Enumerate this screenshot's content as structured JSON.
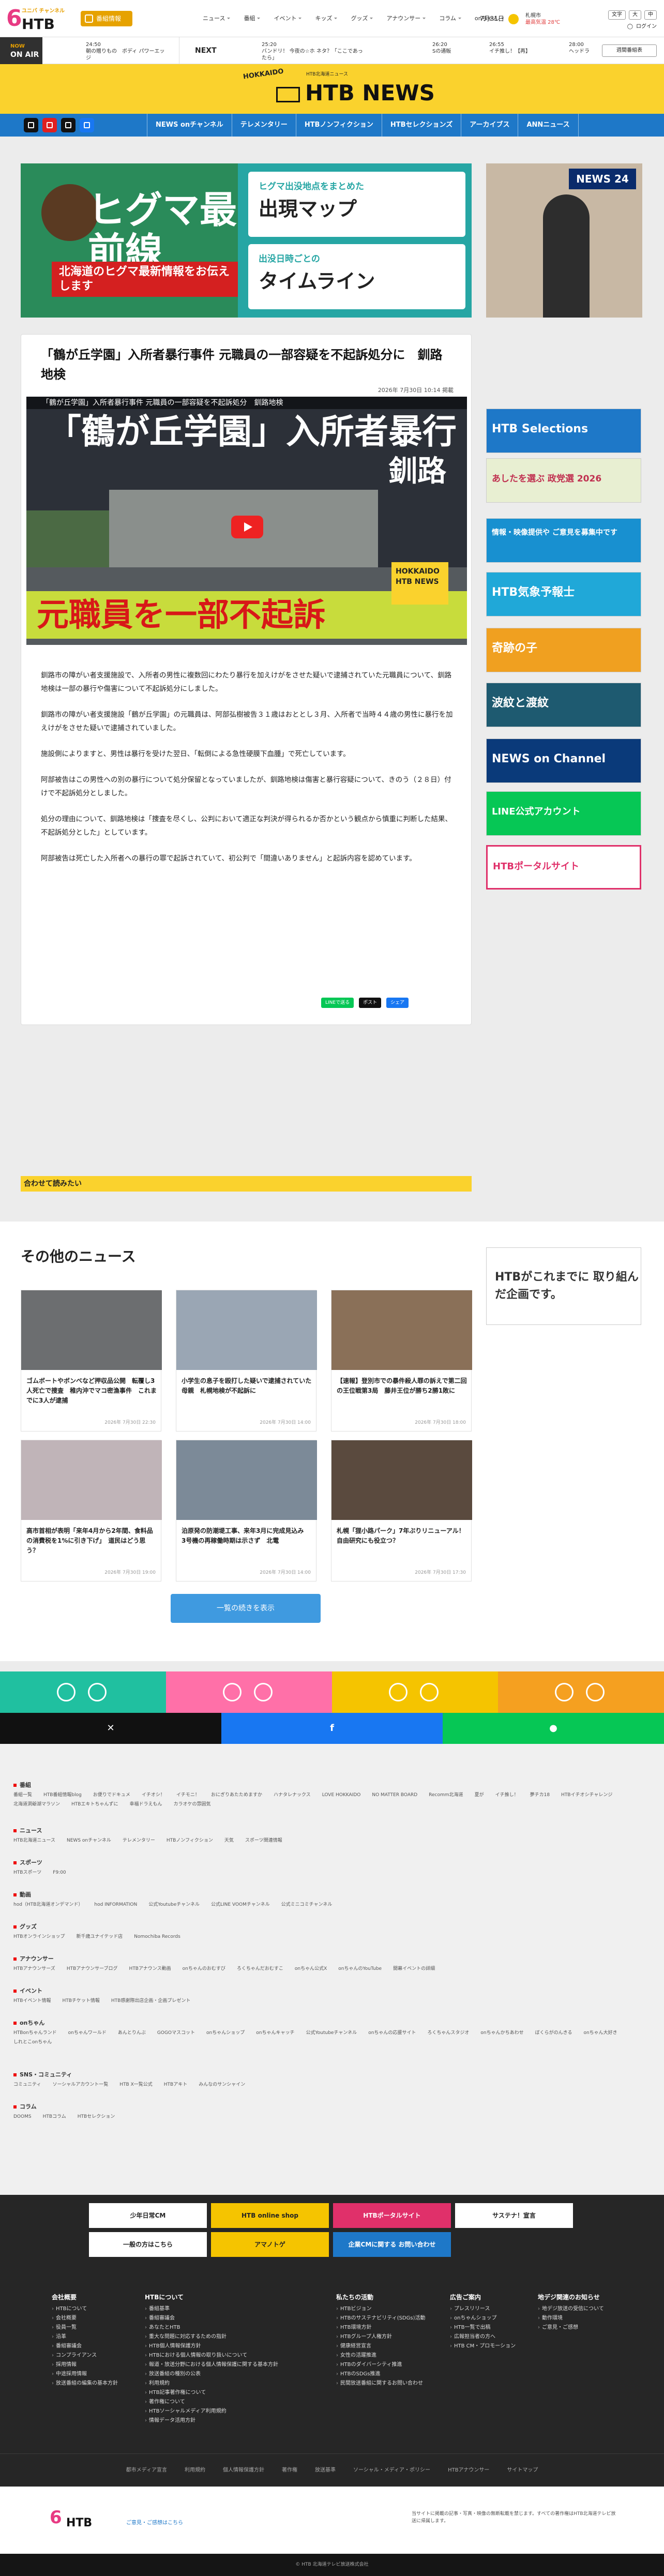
{
  "header": {
    "logo_six": "6",
    "logo_sub": "ユニバ チャンネル",
    "logo_htb": "HTB",
    "fav_button": "番組情報",
    "nav": [
      "ニュース",
      "番組",
      "イベント",
      "キッズ",
      "グッズ",
      "アナウンサー",
      "コラム",
      "onちゃん"
    ],
    "date": "7月31日",
    "location": "札幌市",
    "weather_text": "最高気温 28℃",
    "login": "ログイン",
    "links": [
      "文字",
      "大",
      "中"
    ]
  },
  "onair": {
    "label_now": "NOW",
    "label": "ON AIR",
    "current_time": "24:50",
    "current_title": "朝の贈りもの　ボディ パワーエッジ",
    "next_label": "NEXT",
    "programs": [
      {
        "time": "25:20",
        "title": "バンドリ！ 今夜の☆ホ ネタ？「ここであったら」"
      },
      {
        "time": "26:20",
        "title": "Sの通販"
      },
      {
        "time": "26:55",
        "title": "イチ推し！【再】"
      },
      {
        "time": "28:00",
        "title": "ヘッドラ"
      }
    ],
    "tv_button": "週間番組表"
  },
  "newsbrand": {
    "hokkaido": "HOKKAIDO",
    "sub": "HTB北海道ニュース",
    "word": "HTB NEWS"
  },
  "bluenav": {
    "items": [
      "NEWS onチャンネル",
      "テレメンタリー",
      "HTBノンフィクション",
      "HTBセレクションズ",
      "アーカイブス",
      "ANNニュース"
    ]
  },
  "banner_bear": {
    "title": "ヒグマ最前線",
    "subtitle": "北海道のヒグマ最新情報をお伝えします",
    "box1_small": "ヒグマ出没地点をまとめた",
    "box1_big": "出現マップ",
    "box2_small": "出没日時ごとの",
    "box2_big": "タイムライン"
  },
  "banner_tvasahi": {
    "label": "NEWS 24"
  },
  "article": {
    "title": "「鶴が丘学園」入所者暴行事件 元職員の一部容疑を不起訴処分に　釧路地検",
    "date": "2026年 7月30日 10:14 掲載",
    "video": {
      "caption": "「鶴が丘学園」入所者暴行事件 元職員の一部容疑を不起訴処分　釧路地検",
      "line1": "「鶴が丘学園」入所者暴行",
      "line2": "釧路",
      "band": "元職員を一部不起訴",
      "badge": "HOKKAIDO HTB NEWS"
    },
    "paragraphs": [
      "釧路市の障がい者支援施設で、入所者の男性に複数回にわたり暴行を加えけがをさせた疑いで逮捕されていた元職員について、釧路地検は一部の暴行や傷害について不起訴処分にしました。",
      "釧路市の障がい者支援施設「鶴が丘学園」の元職員は、阿部弘樹被告３１歳はおととし３月、入所者で当時４４歳の男性に暴行を加えけがをさせた疑いで逮捕されていました。",
      "施設側によりますと、男性は暴行を受けた翌日、「転倒による急性硬膜下血腫」で死亡しています。",
      "阿部被告はこの男性への別の暴行について処分保留となっていましたが、釧路地検は傷害と暴行容疑について、きのう（２８日）付けで不起訴処分としました。",
      "処分の理由について、釧路地検は「捜査を尽くし、公判において適正な判決が得られるか否かという観点から慎重に判断した結果、不起訴処分とした」としています。",
      "阿部被告は死亡した入所者への暴行の罪で起訴されていて、初公判で「間違いありません」と起訴内容を認めています。"
    ],
    "share": [
      "LINEで送る",
      "ポスト",
      "シェア"
    ]
  },
  "related": {
    "heading": "合わせて読みたい"
  },
  "sidebar": [
    {
      "label": "HTB Selections",
      "color": "#1e78c8"
    },
    {
      "label": "あしたを選ぶ 政党選 2026",
      "color": "#e0ebc8"
    },
    {
      "label": "情報・映像提供や ご意見を募集中です",
      "color": "#0a8ec8"
    },
    {
      "label": "HTB気象予報士",
      "color": "#20a0d0"
    },
    {
      "label": "奇跡の子",
      "color": "#e8a020"
    },
    {
      "label": "波紋と渡紋",
      "color": "#1e5a70"
    },
    {
      "label": "NEWS on Channel",
      "color": "#0a3a7a"
    },
    {
      "label": "LINE公式アカウント",
      "color": "#06c755"
    },
    {
      "label": "HTBポータルサイト",
      "color": "#e0306a"
    }
  ],
  "other_news": {
    "heading": "その他のニュース",
    "items": [
      {
        "title": "ゴムボートやボンベなど押収品公開　転覆し3人死亡で捜査　稚内沖でマコ密漁事件　これまでに3人が逮捕",
        "date": "2026年 7月30日 22:30"
      },
      {
        "title": "小学生の息子を殴打した疑いで逮捕されていた母親　札幌地検が不起訴に",
        "date": "2026年 7月30日 14:00"
      },
      {
        "title": "【速報】登別市での暴件殺人罪の訴えで第二回の王位戦第3局　藤井王位が勝ち2勝1敗に",
        "date": "2026年 7月30日 18:00"
      },
      {
        "title": "高市首相が表明「来年4月から2年間、食料品の消費税を1%に引き下げ」　道民はどう思う？",
        "date": "2026年 7月30日 19:00"
      },
      {
        "title": "泊原発の防潮堤工事、来年3月に完成見込み　3号機の再稼働時期は示さず　北電",
        "date": "2026年 7月30日 14:00"
      },
      {
        "title": "札幌「狸小路パーク」7年ぶりリニューアル！　自由研究にも役立つ？",
        "date": "2026年 7月30日 17:30"
      }
    ],
    "more_button": "一覧の続きを表示",
    "ad_text": "HTBがこれまでに 取り組んだ企画です。"
  },
  "colors": {
    "accent_yellow": "#fad22d",
    "nav_blue": "#1e78c8",
    "row1": [
      "#20c0a0",
      "#ff70a8",
      "#f5c400",
      "#f5a020"
    ],
    "row2": [
      "#111111",
      "#1877f2",
      "#06c755"
    ]
  },
  "sitemap": [
    {
      "h": "番組",
      "links": [
        "番組一覧",
        "HTB番組情報blog",
        "お便りでドキュメ",
        "イチオシ！",
        "イチモニ！",
        "おにぎりあたためますか",
        "ハナタレナックス",
        "LOVE HOKKAIDO",
        "NO MATTER BOARD",
        "Recomm北海道",
        "夏が",
        "イチ推し！",
        "夢チカ18",
        "HTBイチオシチャレンジ",
        "北海道洞爺湖マラソン",
        "HTBエキトちゃんずに",
        "幸福ドラえもん",
        "カラオケの雰囲気"
      ]
    },
    {
      "h": "ニュース",
      "links": [
        "HTB北海道ニュース",
        "NEWS onチャンネル",
        "テレメンタリー",
        "HTBノンフィクション",
        "天気",
        "スポーツ関連情報"
      ]
    },
    {
      "h": "スポーツ",
      "links": [
        "HTBスポーツ",
        "F9:00"
      ]
    },
    {
      "h": "動画",
      "links": [
        "hod（HTB北海道オンデマンド）",
        "hod INFORMATION",
        "公式Youtubeチャンネル",
        "公式LINE VOOMチャンネル",
        "公式ミニコミチャンネル"
      ]
    },
    {
      "h": "グッズ",
      "links": [
        "HTBオンラインショップ",
        "新千歳ユナイテッド店",
        "Nomochiba Records"
      ]
    },
    {
      "h": "アナウンサー",
      "links": [
        "HTBアナウンサーズ",
        "HTBアナウンサーブログ",
        "HTBアナウンス動画",
        "onちゃんのおむすび",
        "ろくちゃんだおむすこ",
        "onちゃん公式X",
        "onちゃんのYouTube",
        "開幕イベントの詳細"
      ]
    },
    {
      "h": "イベント",
      "links": [
        "HTBイベント情報",
        "HTBチケット情報",
        "HTB感謝際出店企画・企画プレゼント"
      ]
    },
    {
      "h": "onちゃん",
      "links": [
        "HTBonちゃんランド",
        "onちゃんワールド",
        "あんとりんぶ",
        "GOGOマスコット",
        "onちゃんショップ",
        "onちゃんキャッチ",
        "公式Youtubeチャンネル",
        "onちゃんの応援サイト",
        "ろくちゃんスタジオ",
        "onちゃんかちあわせ",
        "ぼくらがのんきる",
        "onちゃん大好き",
        "しれとこonちゃん"
      ]
    },
    {
      "h": "SNS・コミュニティ",
      "links": [
        "コミュニティ",
        "ソーシャルアカウント一覧",
        "HTB X一覧公式",
        "HTBアキト",
        "みんなのサンシャイン"
      ]
    },
    {
      "h": "コラム",
      "links": [
        "DOOMS",
        "HTBコラム",
        "HTBセレクション"
      ]
    }
  ],
  "footer_banners": [
    "少年日常CM",
    "HTB online shop",
    "HTBポータルサイト",
    "サステナ！宣言",
    "一般の方はこちら",
    "アマノトゲ",
    "企業CMに関する お問い合わせ"
  ],
  "footer_cols": [
    {
      "h": "会社概要",
      "items": [
        "HTBについて",
        "会社概要",
        "役員一覧",
        "沿革",
        "番組審議会",
        "コンプライアンス",
        "採用情報",
        "中途採用情報",
        "放送番組の編集の基本方針"
      ]
    },
    {
      "h": "HTBについて",
      "items": [
        "番組基準",
        "番組審議会",
        "あなたとHTB",
        "重大な問題に対応するための指針",
        "HTB個人情報保護方針",
        "HTBにおける個人情報の取り扱いについて",
        "報道・放送分野における個人情報保護に関する基本方針",
        "放送番組の種別の公表",
        "利用規約",
        "HTB記事著作権について",
        "著作権について",
        "HTBソーシャルメディア利用規約",
        "情報データ活用方針"
      ]
    },
    {
      "h": "私たちの活動",
      "items": [
        "HTBビジョン",
        "HTBのサステナビリティ(SDGs)活動",
        "HTB環境方針",
        "HTBグループ人権方針",
        "健康経営宣言",
        "女性の活躍推進",
        "HTBのダイバーシティ推進",
        "HTBのSDGs推進",
        "民間放送番組に関するお問い合わせ"
      ]
    },
    {
      "h": "広告ご案内",
      "items": [
        "プレスリリース",
        "onちゃんショップ",
        "HTB一覧で出稿",
        "広報担当者の方へ",
        "HTB CM・プロモーション"
      ]
    },
    {
      "h": "地デジ関連のお知らせ",
      "items": [
        "地デジ放送の受信について",
        "動作環境",
        "ご意見・ご感想"
      ]
    }
  ],
  "legal": [
    "都市メディア宣言",
    "利用規約",
    "個人情報保護方針",
    "著作権",
    "放送基準",
    "ソーシャル・メディア・ポリシー",
    "HTBアナウンサー",
    "サイトマップ"
  ],
  "bottom": {
    "note": "ご意見・ご感想はこちら",
    "right_text": "当サイトに掲載の記事・写真・映像の無断転載を禁じます。すべての著作権はHTB北海道テレビ放送に帰属します。",
    "copyright": "© HTB 北海道テレビ放送株式会社"
  }
}
